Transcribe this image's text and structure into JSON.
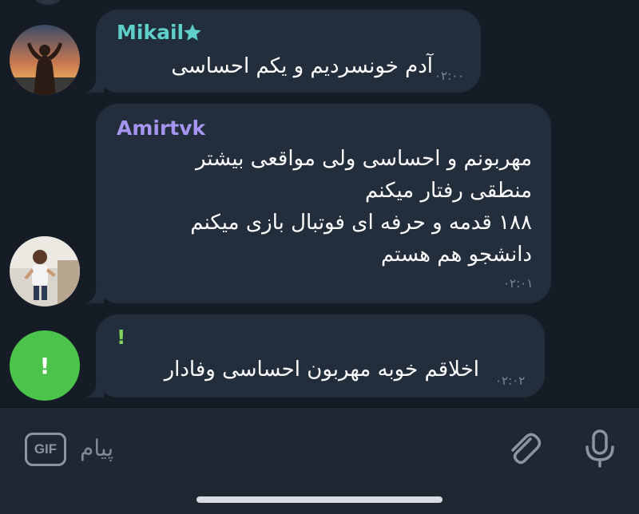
{
  "messages": [
    {
      "sender": "Mikail",
      "sender_color": "#5fd0c9",
      "badge": "star-icon",
      "text": "آدم خونسردیم و یکم احساسی",
      "time": "۰۲:۰۰"
    },
    {
      "sender": "Amirtvk",
      "sender_color": "#a695f0",
      "lines": [
        "مهربونم و احساسی ولی مواقعی بیشتر",
        "منطقی رفتار میکنم",
        "۱۸۸ قدمه و حرفه ای فوتبال بازی میکنم",
        "دانشجو هم هستم"
      ],
      "time": "۰۲:۰۱"
    },
    {
      "sender": "!",
      "sender_color": "#7fd45a",
      "avatar_letter": "!",
      "avatar_color": "#4cc34a",
      "text": "اخلاقم خوبه مهربون احساسی وفادار",
      "time": "۰۲:۰۲"
    }
  ],
  "composer": {
    "gif_label": "GIF",
    "placeholder": "پیام"
  },
  "colors": {
    "background": "#151c26",
    "bubble": "#232e3c",
    "composer": "#1e2732"
  }
}
